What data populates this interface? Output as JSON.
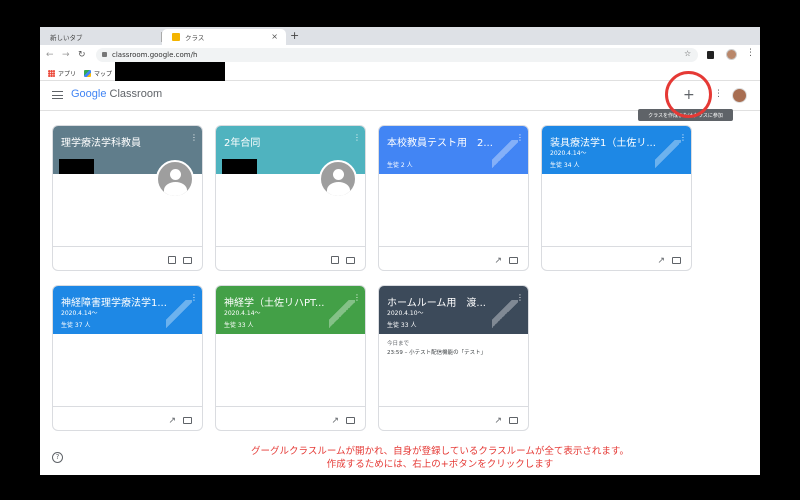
{
  "browser": {
    "tabs": [
      {
        "label": "新しいタブ",
        "active": false
      },
      {
        "label": "クラス",
        "active": true
      }
    ],
    "tab_close": "×",
    "new_tab": "+",
    "url": "classroom.google.com/h",
    "bookmarks": [
      {
        "label": "アプリ",
        "icon": "apps-grid-icon"
      },
      {
        "label": "マップ",
        "icon": "maps-icon"
      }
    ]
  },
  "app": {
    "logo_google": "Google",
    "logo_classroom": "Classroom",
    "plus_label": "+",
    "tooltip": "クラスを作成またはクラスに参加"
  },
  "courses": [
    {
      "title": "理学療法学科教員",
      "subtitle": "",
      "students": "",
      "color": "#607d8b",
      "footer": [
        "person",
        "folder"
      ],
      "redacted": true,
      "avatar": true
    },
    {
      "title": "2年合同",
      "subtitle": "",
      "students": "",
      "color": "#4fb3bf",
      "footer": [
        "person",
        "folder"
      ],
      "redacted": true,
      "avatar": true
    },
    {
      "title": "本校教員テスト用　2...",
      "subtitle": "",
      "students": "生徒 2 人",
      "color": "#4285f4",
      "footer": [
        "trend",
        "folder"
      ]
    },
    {
      "title": "装具療法学1（土佐リ...",
      "subtitle": "2020.4.14～",
      "students": "生徒 34 人",
      "color": "#1e88e5",
      "footer": [
        "trend",
        "folder"
      ]
    },
    {
      "title": "神経障害理学療法学1...",
      "subtitle": "2020.4.14～",
      "students": "生徒 37 人",
      "color": "#1e88e5",
      "footer": [
        "trend",
        "folder"
      ]
    },
    {
      "title": "神経学（土佐リハPT...",
      "subtitle": "2020.4.14～",
      "students": "生徒 33 人",
      "color": "#43a047",
      "footer": [
        "trend",
        "folder"
      ]
    },
    {
      "title": "ホームルーム用　渡...",
      "subtitle": "2020.4.10～",
      "students": "生徒 33 人",
      "color": "#3c4a5a",
      "footer": [
        "trend",
        "folder"
      ],
      "due_label": "今日まで",
      "due_item": "23:59 – 小テスト配信機能の「テスト」"
    }
  ],
  "caption": {
    "line1": "グーグルクラスルームが開かれ、自身が登録しているクラスルームが全て表示されます。",
    "line2": "作成するためには、右上の+ボタンをクリックします"
  },
  "colors": {
    "annotation": "#e53935"
  }
}
